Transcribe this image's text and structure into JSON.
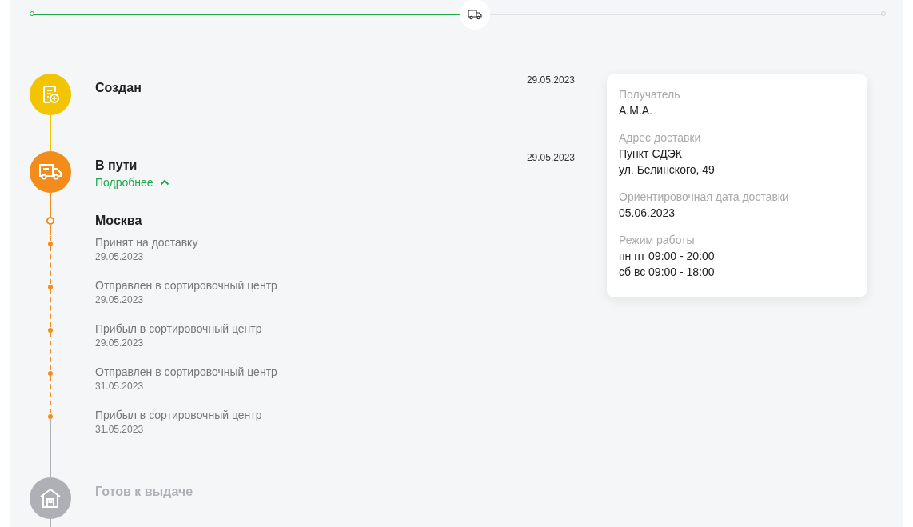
{
  "progress": {
    "level": 0.52
  },
  "stages": [
    {
      "kind": "created",
      "title": "Создан",
      "date": "29.05.2023",
      "color": "#f2c500",
      "reached": true
    },
    {
      "kind": "transit",
      "title": "В пути",
      "date": "29.05.2023",
      "color": "#f28c1b",
      "reached": true,
      "details_link": "Подробнее",
      "expanded": true,
      "city": "Москва",
      "events": [
        {
          "text": "Принят на доставку",
          "date": "29.05.2023"
        },
        {
          "text": "Отправлен в сортировочный центр",
          "date": "29.05.2023"
        },
        {
          "text": "Прибыл в сортировочный центр",
          "date": "29.05.2023"
        },
        {
          "text": "Отправлен в сортировочный центр",
          "date": "31.05.2023"
        },
        {
          "text": "Прибыл в сортировочный центр",
          "date": "31.05.2023"
        }
      ]
    },
    {
      "kind": "ready",
      "title": "Готов к выдаче",
      "color": "#aeb0b5",
      "reached": false
    }
  ],
  "info_card": {
    "fields": [
      {
        "label": "Получатель",
        "lines": [
          "А.М.А."
        ]
      },
      {
        "label": "Адрес доставки",
        "lines": [
          "Пункт СДЭК",
          "ул. Белинского, 49"
        ]
      },
      {
        "label": "Ориентировочная дата доставки",
        "lines": [
          "05.06.2023"
        ]
      },
      {
        "label": "Режим работы",
        "lines": [
          "пн пт 09:00 - 20:00",
          "сб вс 09:00 - 18:00"
        ]
      }
    ]
  }
}
